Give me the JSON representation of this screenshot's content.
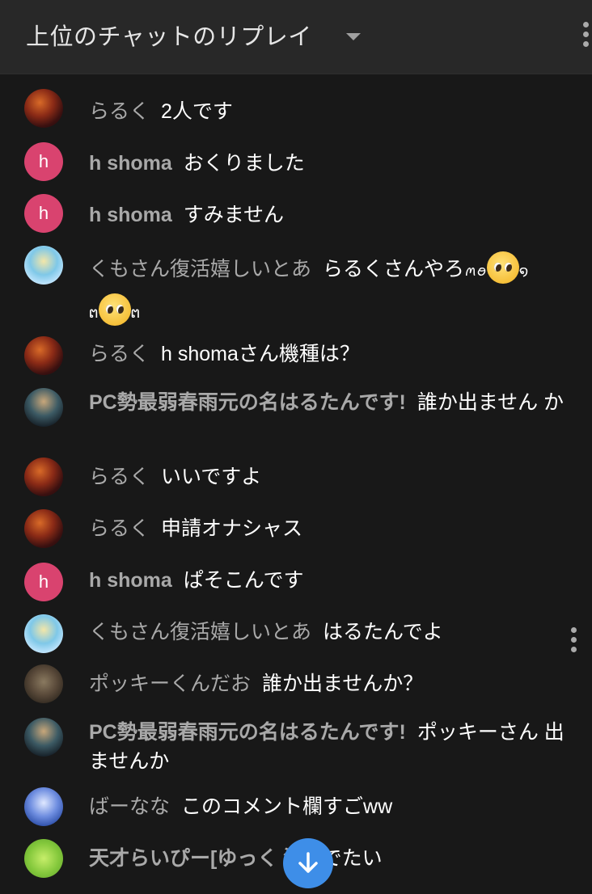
{
  "header": {
    "title": "上位のチャットのリプレイ"
  },
  "messages": [
    {
      "author": "らるく",
      "text": "2人です"
    },
    {
      "author": "h shoma",
      "avatar_letter": "h",
      "text": "おくりました"
    },
    {
      "author": "h shoma",
      "avatar_letter": "h",
      "text": "すみません"
    },
    {
      "author": "くもさん復活嬉しいとあ",
      "text_a": "らるくさんやろ",
      "text_b": "ꪔ",
      "text_c": "ꪔ",
      "text_d": "ꪔ",
      "text_lead": "ꪮ꒰"
    },
    {
      "author": "らるく",
      "text": "h shomaさん機種は？"
    },
    {
      "author": "PC勢最弱春雨元の名はるたんです!",
      "text": "誰か出ません か"
    },
    {
      "author": "らるく",
      "text": "いいですよ"
    },
    {
      "author": "らるく",
      "text": "申請オナシャス"
    },
    {
      "author": "h shoma",
      "avatar_letter": "h",
      "text": "ぱそこんです"
    },
    {
      "author": "くもさん復活嬉しいとあ",
      "text": "はるたんでよ"
    },
    {
      "author": "ポッキーくんだお",
      "text": "誰か出ませんか？"
    },
    {
      "author": "PC勢最弱春雨元の名はるたんです!",
      "text": "ポッキーさん 出ませんか"
    },
    {
      "author": "ばーなな",
      "text": "このコメント欄すごww"
    },
    {
      "author": "天才らいぴー[ゆっく 況]",
      "text": "でたい"
    }
  ],
  "icons": {
    "header_caret": "caret-down-icon",
    "header_menu": "more-vert-icon",
    "row_menu": "more-vert-icon",
    "scroll_button": "arrow-down-icon",
    "emoji": "pleading-face-icon"
  },
  "colors": {
    "background": "#181818",
    "header_bg": "#282828",
    "author_text": "#a9a9a9",
    "message_text": "#ffffff",
    "avatar_h": "#d9436f",
    "scroll_button": "#3e8ee8"
  }
}
